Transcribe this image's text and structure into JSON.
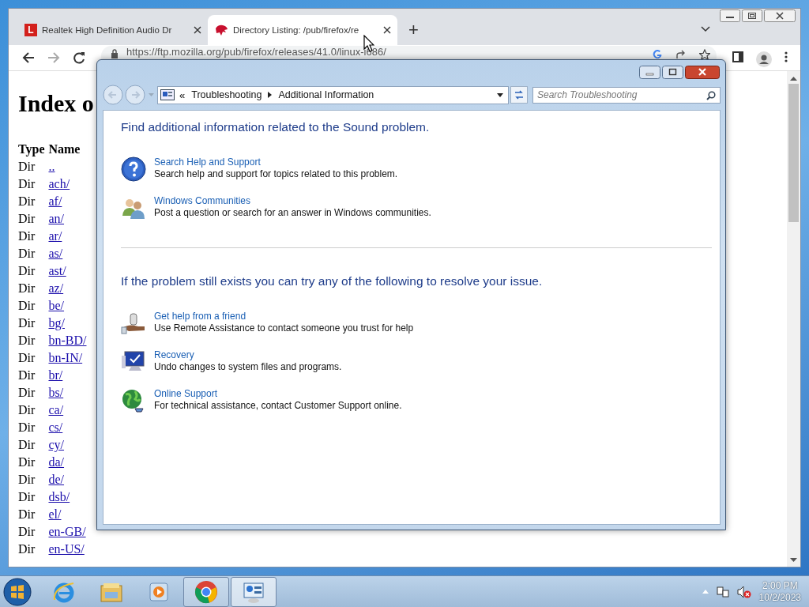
{
  "browser": {
    "tabs": [
      {
        "kind": "letter",
        "favicon_letter": "L",
        "title": "Realtek High Definition Audio Dr",
        "selected": false
      },
      {
        "kind": "dino",
        "title": "Directory Listing: /pub/firefox/re",
        "selected": true
      }
    ],
    "new_tab": "+",
    "address": "https://ftp.mozilla.org/pub/firefox/releases/41.0/linux-i686/",
    "page": {
      "heading": "Index o",
      "columns": [
        "Type",
        "Name"
      ],
      "rows": [
        {
          "type": "Dir",
          "name": ".."
        },
        {
          "type": "Dir",
          "name": "ach/"
        },
        {
          "type": "Dir",
          "name": "af/"
        },
        {
          "type": "Dir",
          "name": "an/"
        },
        {
          "type": "Dir",
          "name": "ar/"
        },
        {
          "type": "Dir",
          "name": "as/"
        },
        {
          "type": "Dir",
          "name": "ast/"
        },
        {
          "type": "Dir",
          "name": "az/"
        },
        {
          "type": "Dir",
          "name": "be/"
        },
        {
          "type": "Dir",
          "name": "bg/"
        },
        {
          "type": "Dir",
          "name": "bn-BD/"
        },
        {
          "type": "Dir",
          "name": "bn-IN/"
        },
        {
          "type": "Dir",
          "name": "br/"
        },
        {
          "type": "Dir",
          "name": "bs/"
        },
        {
          "type": "Dir",
          "name": "ca/"
        },
        {
          "type": "Dir",
          "name": "cs/"
        },
        {
          "type": "Dir",
          "name": "cy/"
        },
        {
          "type": "Dir",
          "name": "da/"
        },
        {
          "type": "Dir",
          "name": "de/"
        },
        {
          "type": "Dir",
          "name": "dsb/"
        },
        {
          "type": "Dir",
          "name": "el/"
        },
        {
          "type": "Dir",
          "name": "en-GB/"
        },
        {
          "type": "Dir",
          "name": "en-US/"
        }
      ]
    }
  },
  "dialog": {
    "breadcrumb_prefix": "«",
    "breadcrumb": [
      "Troubleshooting",
      "Additional Information"
    ],
    "search": {
      "placeholder": "Search Troubleshooting"
    },
    "sections": [
      {
        "heading": "Find additional information related to the Sound problem.",
        "items": [
          {
            "kind": "help",
            "title": "Search Help and Support",
            "description": "Search help and support for topics related to this problem."
          },
          {
            "kind": "community",
            "title": "Windows Communities",
            "description": "Post a question or search for an answer in Windows communities."
          }
        ]
      },
      {
        "heading": "If the problem still exists you can try any of the following to resolve your issue.",
        "items": [
          {
            "kind": "friend",
            "title": "Get help from a friend",
            "description": "Use Remote Assistance to contact someone you trust for help"
          },
          {
            "kind": "recovery",
            "title": "Recovery",
            "description": "Undo changes to system files and programs."
          },
          {
            "kind": "online",
            "title": "Online Support",
            "description": "For technical assistance, contact Customer Support online."
          }
        ]
      }
    ]
  },
  "taskbar": {
    "apps": [
      {
        "kind": "ie",
        "running": false,
        "selected": false
      },
      {
        "kind": "explorer",
        "running": false,
        "selected": false
      },
      {
        "kind": "media",
        "running": false,
        "selected": false
      },
      {
        "kind": "chrome",
        "running": true,
        "selected": false
      },
      {
        "kind": "control",
        "running": true,
        "selected": true
      }
    ],
    "clock": {
      "time": "2:00 PM",
      "date": "10/2/2023"
    }
  }
}
